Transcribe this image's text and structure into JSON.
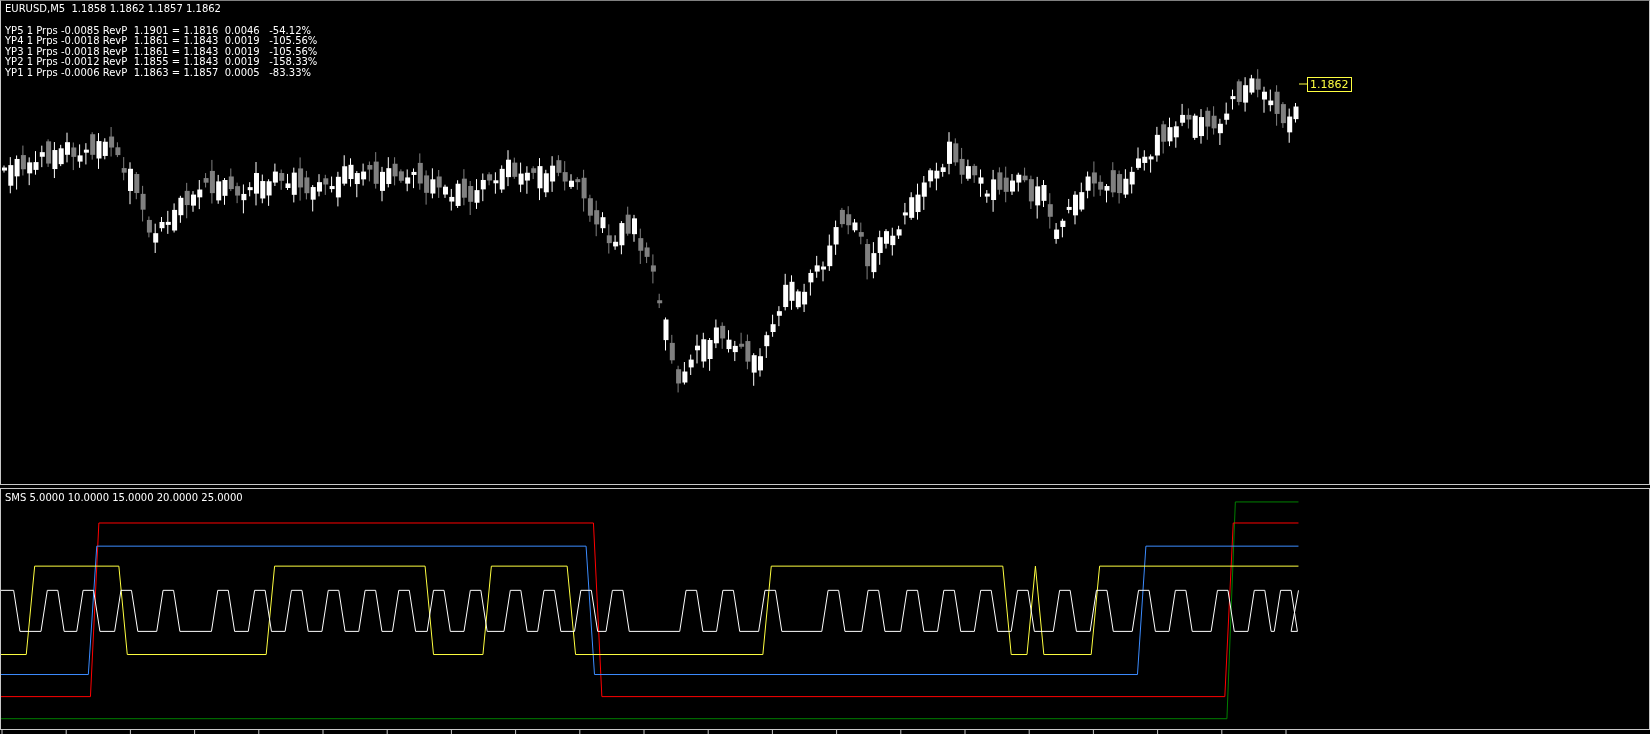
{
  "main_pane": {
    "header": "EURUSD,M5  1.1858 1.1862 1.1857 1.1862",
    "levels": [
      "YP5 1 Prps -0.0085 RevP  1.1901 = 1.1816  0.0046   -54.12%",
      "YP4 1 Prps -0.0018 RevP  1.1861 = 1.1843  0.0019   -105.56%",
      "YP3 1 Prps -0.0018 RevP  1.1861 = 1.1843  0.0019   -105.56%",
      "YP2 1 Prps -0.0012 RevP  1.1855 = 1.1843  0.0019   -158.33%",
      "YP1 1 Prps -0.0006 RevP  1.1863 = 1.1857  0.0005   -83.33%"
    ],
    "price_label": "1.1862"
  },
  "indicator_pane": {
    "label": "SMS 5.0000 10.0000 15.0000 20.0000 25.0000",
    "lines": [
      {
        "color": "#008000"
      },
      {
        "color": "#ff0000"
      },
      {
        "color": "#3c8cff"
      },
      {
        "color": "#ffff40"
      },
      {
        "color": "#ffffff"
      }
    ]
  }
}
